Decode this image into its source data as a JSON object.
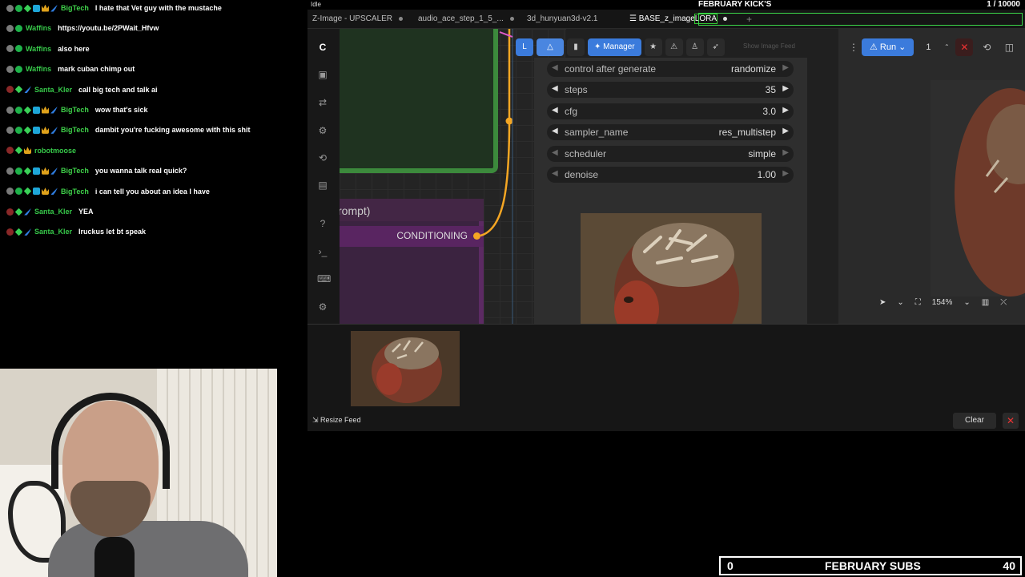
{
  "chat": {
    "messages": [
      {
        "user": "BigTech",
        "color": "#3fd24a",
        "badges": [
          "mod",
          "ok",
          "vip",
          "sub",
          "crown",
          "knife"
        ],
        "text": "I hate that Vet guy with the mustache"
      },
      {
        "user": "Waffins",
        "color": "#37c94a",
        "badges": [
          "mod",
          "ok"
        ],
        "text": "https://youtu.be/2PWait_Hfvw"
      },
      {
        "user": "Waffins",
        "color": "#37c94a",
        "badges": [
          "mod",
          "ok"
        ],
        "text": "also here"
      },
      {
        "user": "Waffins",
        "color": "#37c94a",
        "badges": [
          "mod",
          "ok"
        ],
        "text": "mark cuban chimp out"
      },
      {
        "user": "Santa_Kler",
        "color": "#37c94a",
        "badges": [
          "dark",
          "vip",
          "knife"
        ],
        "text": "call big tech and talk ai"
      },
      {
        "user": "BigTech",
        "color": "#3fd24a",
        "badges": [
          "mod",
          "ok",
          "vip",
          "sub",
          "crown",
          "knife"
        ],
        "text": "wow that's sick"
      },
      {
        "user": "BigTech",
        "color": "#3fd24a",
        "badges": [
          "mod",
          "ok",
          "vip",
          "sub",
          "crown",
          "knife"
        ],
        "text": "dambit you're fucking awesome with this shit"
      },
      {
        "user": "robotmoose",
        "color": "#37c94a",
        "badges": [
          "dark",
          "vip",
          "crown"
        ],
        "text": ""
      },
      {
        "user": "BigTech",
        "color": "#3fd24a",
        "badges": [
          "mod",
          "ok",
          "vip",
          "sub",
          "crown",
          "knife"
        ],
        "text": "you wanna talk real quick?"
      },
      {
        "user": "BigTech",
        "color": "#3fd24a",
        "badges": [
          "mod",
          "ok",
          "vip",
          "sub",
          "crown",
          "knife"
        ],
        "text": "i can tell you about an idea I have"
      },
      {
        "user": "Santa_Kler",
        "color": "#37c94a",
        "badges": [
          "dark",
          "vip",
          "knife"
        ],
        "text": "YEA"
      },
      {
        "user": "Santa_Kler",
        "color": "#37c94a",
        "badges": [
          "dark",
          "vip",
          "knife"
        ],
        "text": "lruckus let bt speak"
      }
    ]
  },
  "stream": {
    "status": "Idle",
    "kicks_title": "FEBRUARY KICK'S",
    "kicks_counter": "1 / 10000",
    "subs_current": "0",
    "subs_label": "FEBRUARY SUBS",
    "subs_goal": "40"
  },
  "tabs": [
    {
      "label": "Z-Image - UPSCALER"
    },
    {
      "label": "audio_ace_step_1_5_..."
    },
    {
      "label": "3d_hunyuan3d-v2.1"
    },
    {
      "label": "BASE_z_image",
      "highlight": "LORA"
    }
  ],
  "toolbar": {
    "manager_label": "Manager",
    "show_feed_label": "Show Image Feed",
    "run_label": "Run",
    "run_count": "1"
  },
  "ksampler": {
    "params": [
      {
        "name": "control after generate",
        "value": "randomize"
      },
      {
        "name": "steps",
        "value": "35"
      },
      {
        "name": "cfg",
        "value": "3.0"
      },
      {
        "name": "sampler_name",
        "value": "res_multistep"
      },
      {
        "name": "scheduler",
        "value": "simple"
      },
      {
        "name": "denoise",
        "value": "1.00"
      }
    ]
  },
  "canvas": {
    "node_title": "rompt)",
    "output_label": "CONDITIONING"
  },
  "zoom": {
    "level": "154%"
  },
  "feed": {
    "resize_label": "Resize Feed",
    "clear_label": "Clear"
  },
  "colors": {
    "accent": "#3b7bdc",
    "wire": "#f5a623",
    "green_node": "#3c8a3c",
    "purple_node": "#5c2a63",
    "cancel": "#e33333"
  }
}
